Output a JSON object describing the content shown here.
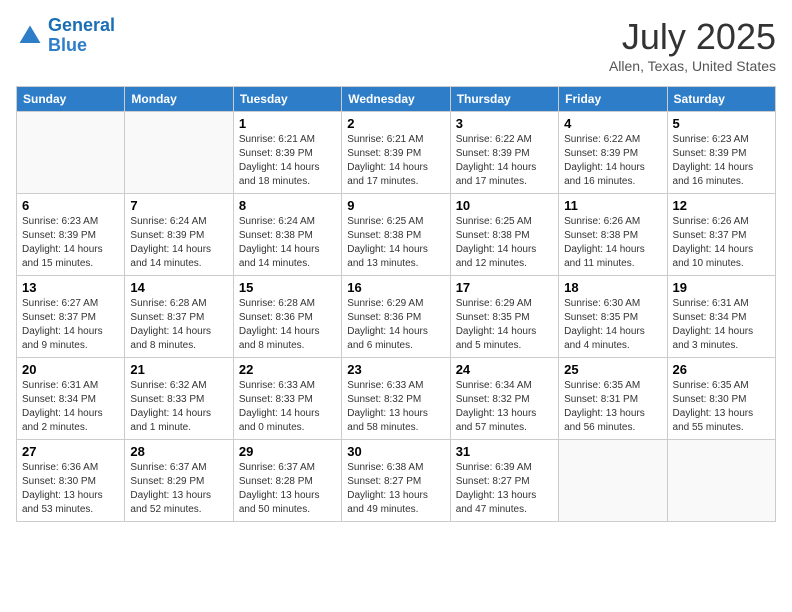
{
  "header": {
    "logo_line1": "General",
    "logo_line2": "Blue",
    "month_year": "July 2025",
    "location": "Allen, Texas, United States"
  },
  "calendar": {
    "days_of_week": [
      "Sunday",
      "Monday",
      "Tuesday",
      "Wednesday",
      "Thursday",
      "Friday",
      "Saturday"
    ],
    "weeks": [
      [
        {
          "day": "",
          "info": ""
        },
        {
          "day": "",
          "info": ""
        },
        {
          "day": "1",
          "info": "Sunrise: 6:21 AM\nSunset: 8:39 PM\nDaylight: 14 hours and 18 minutes."
        },
        {
          "day": "2",
          "info": "Sunrise: 6:21 AM\nSunset: 8:39 PM\nDaylight: 14 hours and 17 minutes."
        },
        {
          "day": "3",
          "info": "Sunrise: 6:22 AM\nSunset: 8:39 PM\nDaylight: 14 hours and 17 minutes."
        },
        {
          "day": "4",
          "info": "Sunrise: 6:22 AM\nSunset: 8:39 PM\nDaylight: 14 hours and 16 minutes."
        },
        {
          "day": "5",
          "info": "Sunrise: 6:23 AM\nSunset: 8:39 PM\nDaylight: 14 hours and 16 minutes."
        }
      ],
      [
        {
          "day": "6",
          "info": "Sunrise: 6:23 AM\nSunset: 8:39 PM\nDaylight: 14 hours and 15 minutes."
        },
        {
          "day": "7",
          "info": "Sunrise: 6:24 AM\nSunset: 8:39 PM\nDaylight: 14 hours and 14 minutes."
        },
        {
          "day": "8",
          "info": "Sunrise: 6:24 AM\nSunset: 8:38 PM\nDaylight: 14 hours and 14 minutes."
        },
        {
          "day": "9",
          "info": "Sunrise: 6:25 AM\nSunset: 8:38 PM\nDaylight: 14 hours and 13 minutes."
        },
        {
          "day": "10",
          "info": "Sunrise: 6:25 AM\nSunset: 8:38 PM\nDaylight: 14 hours and 12 minutes."
        },
        {
          "day": "11",
          "info": "Sunrise: 6:26 AM\nSunset: 8:38 PM\nDaylight: 14 hours and 11 minutes."
        },
        {
          "day": "12",
          "info": "Sunrise: 6:26 AM\nSunset: 8:37 PM\nDaylight: 14 hours and 10 minutes."
        }
      ],
      [
        {
          "day": "13",
          "info": "Sunrise: 6:27 AM\nSunset: 8:37 PM\nDaylight: 14 hours and 9 minutes."
        },
        {
          "day": "14",
          "info": "Sunrise: 6:28 AM\nSunset: 8:37 PM\nDaylight: 14 hours and 8 minutes."
        },
        {
          "day": "15",
          "info": "Sunrise: 6:28 AM\nSunset: 8:36 PM\nDaylight: 14 hours and 8 minutes."
        },
        {
          "day": "16",
          "info": "Sunrise: 6:29 AM\nSunset: 8:36 PM\nDaylight: 14 hours and 6 minutes."
        },
        {
          "day": "17",
          "info": "Sunrise: 6:29 AM\nSunset: 8:35 PM\nDaylight: 14 hours and 5 minutes."
        },
        {
          "day": "18",
          "info": "Sunrise: 6:30 AM\nSunset: 8:35 PM\nDaylight: 14 hours and 4 minutes."
        },
        {
          "day": "19",
          "info": "Sunrise: 6:31 AM\nSunset: 8:34 PM\nDaylight: 14 hours and 3 minutes."
        }
      ],
      [
        {
          "day": "20",
          "info": "Sunrise: 6:31 AM\nSunset: 8:34 PM\nDaylight: 14 hours and 2 minutes."
        },
        {
          "day": "21",
          "info": "Sunrise: 6:32 AM\nSunset: 8:33 PM\nDaylight: 14 hours and 1 minute."
        },
        {
          "day": "22",
          "info": "Sunrise: 6:33 AM\nSunset: 8:33 PM\nDaylight: 14 hours and 0 minutes."
        },
        {
          "day": "23",
          "info": "Sunrise: 6:33 AM\nSunset: 8:32 PM\nDaylight: 13 hours and 58 minutes."
        },
        {
          "day": "24",
          "info": "Sunrise: 6:34 AM\nSunset: 8:32 PM\nDaylight: 13 hours and 57 minutes."
        },
        {
          "day": "25",
          "info": "Sunrise: 6:35 AM\nSunset: 8:31 PM\nDaylight: 13 hours and 56 minutes."
        },
        {
          "day": "26",
          "info": "Sunrise: 6:35 AM\nSunset: 8:30 PM\nDaylight: 13 hours and 55 minutes."
        }
      ],
      [
        {
          "day": "27",
          "info": "Sunrise: 6:36 AM\nSunset: 8:30 PM\nDaylight: 13 hours and 53 minutes."
        },
        {
          "day": "28",
          "info": "Sunrise: 6:37 AM\nSunset: 8:29 PM\nDaylight: 13 hours and 52 minutes."
        },
        {
          "day": "29",
          "info": "Sunrise: 6:37 AM\nSunset: 8:28 PM\nDaylight: 13 hours and 50 minutes."
        },
        {
          "day": "30",
          "info": "Sunrise: 6:38 AM\nSunset: 8:27 PM\nDaylight: 13 hours and 49 minutes."
        },
        {
          "day": "31",
          "info": "Sunrise: 6:39 AM\nSunset: 8:27 PM\nDaylight: 13 hours and 47 minutes."
        },
        {
          "day": "",
          "info": ""
        },
        {
          "day": "",
          "info": ""
        }
      ]
    ]
  }
}
